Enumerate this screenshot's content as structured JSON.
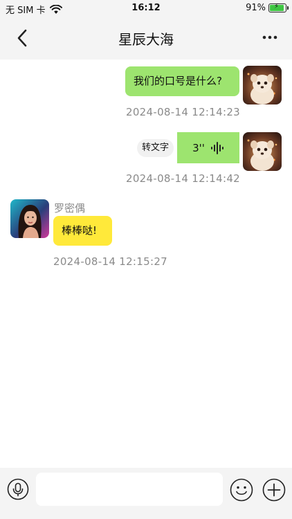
{
  "status_bar": {
    "carrier": "无 SIM 卡",
    "time": "16:12",
    "battery_text": "91%",
    "battery_level": 0.91,
    "icons": [
      "wifi-icon",
      "battery-icon",
      "charging-bolt-icon"
    ]
  },
  "nav": {
    "title": "星辰大海",
    "back_icon": "chevron-left-icon",
    "more_icon": "more-dots-icon"
  },
  "messages": [
    {
      "id": "m1",
      "direction": "outgoing",
      "type": "text",
      "text": "我们的口号是什么?",
      "timestamp": "2024-08-14 12:14:23",
      "avatar": "fluffy-puppy-avatar"
    },
    {
      "id": "m2",
      "direction": "outgoing",
      "type": "voice",
      "duration": "3''",
      "convert_label": "转文字",
      "timestamp": "2024-08-14 12:14:42",
      "avatar": "fluffy-puppy-avatar"
    },
    {
      "id": "m3",
      "direction": "incoming",
      "type": "text",
      "sender": "罗密偶",
      "text": "棒棒哒!",
      "timestamp": "2024-08-14 12:15:27",
      "avatar": "woman-portrait-avatar"
    }
  ],
  "input_bar": {
    "placeholder": "",
    "value": "",
    "icons": [
      "microphone-icon",
      "emoji-icon",
      "plus-icon"
    ]
  },
  "colors": {
    "outgoing_bubble": "#9de46f",
    "incoming_bubble": "#ffe93a",
    "bar_background": "#f4f4f4",
    "timestamp_text": "#8a8a8a"
  }
}
